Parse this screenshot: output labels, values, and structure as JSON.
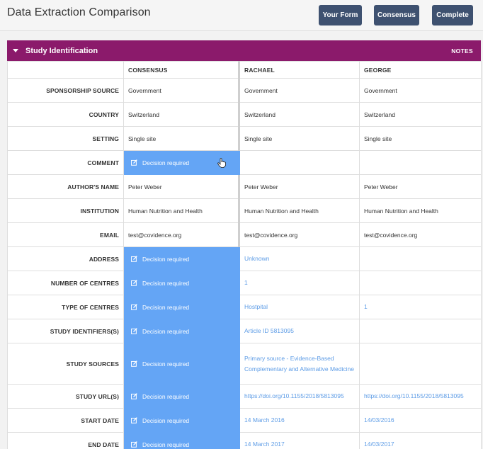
{
  "header": {
    "title": "Data Extraction Comparison",
    "buttons": {
      "your_form": "Your Form",
      "consensus": "Consensus",
      "complete": "Complete"
    }
  },
  "section": {
    "title": "Study Identification",
    "notes_label": "NOTES"
  },
  "columns": [
    "CONSENSUS",
    "RACHAEL",
    "GEORGE"
  ],
  "decision_label": "Decision required",
  "rows": [
    {
      "label": "SPONSORSHIP SOURCE",
      "consensus": "Government",
      "rachael": "Government",
      "george": "Government",
      "decision": false
    },
    {
      "label": "COUNTRY",
      "consensus": "Switzerland",
      "rachael": "Switzerland",
      "george": "Switzerland",
      "decision": false
    },
    {
      "label": "SETTING",
      "consensus": "Single site",
      "rachael": "Single site",
      "george": "Single site",
      "decision": false
    },
    {
      "label": "COMMENT",
      "consensus": "",
      "rachael": "",
      "george": "",
      "decision": true
    },
    {
      "label": "AUTHOR'S NAME",
      "consensus": "Peter Weber",
      "rachael": "Peter Weber",
      "george": "Peter Weber",
      "decision": false
    },
    {
      "label": "INSTITUTION",
      "consensus": "Human Nutrition and Health",
      "rachael": "Human Nutrition and Health",
      "george": "Human Nutrition and Health",
      "decision": false
    },
    {
      "label": "EMAIL",
      "consensus": "test@covidence.org",
      "rachael": "test@covidence.org",
      "george": "test@covidence.org",
      "decision": false
    },
    {
      "label": "ADDRESS",
      "consensus": "",
      "rachael": "Unknown",
      "george": "",
      "decision": true
    },
    {
      "label": "NUMBER OF CENTRES",
      "consensus": "",
      "rachael": "1",
      "george": "",
      "decision": true
    },
    {
      "label": "TYPE OF CENTRES",
      "consensus": "",
      "rachael": "Hostpital",
      "george": "1",
      "decision": true
    },
    {
      "label": "STUDY IDENTIFIERS(S)",
      "consensus": "",
      "rachael": "Article ID 5813095",
      "george": "",
      "decision": true
    },
    {
      "label": "STUDY SOURCES",
      "consensus": "",
      "rachael": "Primary source - Evidence-Based Complementary and Alternative Medicine",
      "george": "",
      "decision": true
    },
    {
      "label": "STUDY URL(S)",
      "consensus": "",
      "rachael": "https://doi.org/10.1155/2018/5813095",
      "george": "https://doi.org/10.1155/2018/5813095",
      "decision": true
    },
    {
      "label": "START DATE",
      "consensus": "",
      "rachael": "14 March 2016",
      "george": "14/03/2016",
      "decision": true
    },
    {
      "label": "END DATE",
      "consensus": "",
      "rachael": "14 March 2017",
      "george": "14/03/2017",
      "decision": true
    }
  ],
  "colors": {
    "section_header": "#8b1a6b",
    "button": "#3e5170",
    "decision": "#64a5f5",
    "link": "#5d9ce6"
  },
  "icons": {
    "edit": "edit-square-icon",
    "cursor": "pointer-hand-icon"
  }
}
